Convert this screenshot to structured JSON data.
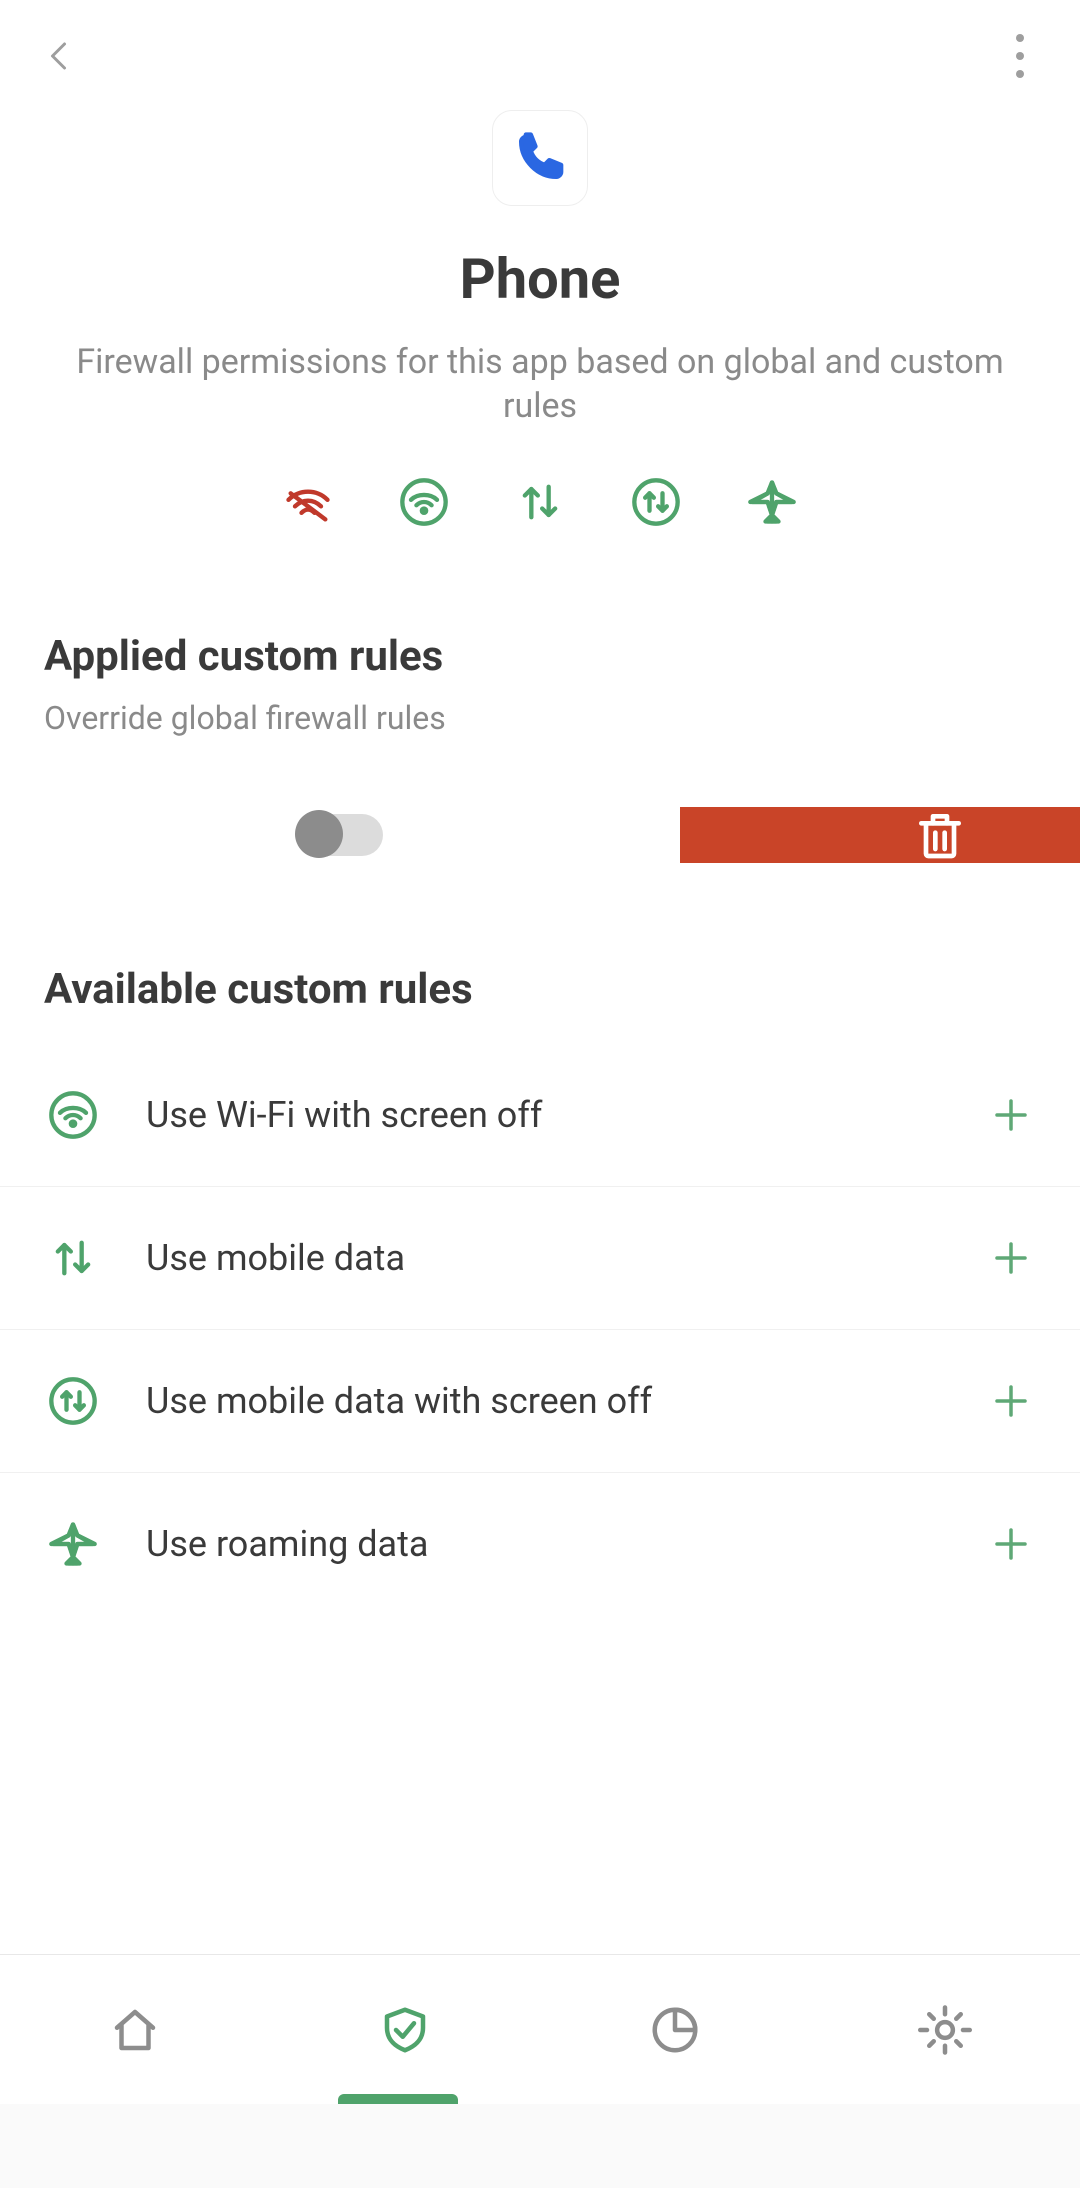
{
  "app": {
    "title": "Phone",
    "subtitle": "Firewall permissions for this app based on global and custom rules"
  },
  "permission_icons": [
    {
      "name": "wifi-blocked",
      "color": "red"
    },
    {
      "name": "wifi-circle",
      "color": "green"
    },
    {
      "name": "mobile-data",
      "color": "green"
    },
    {
      "name": "mobile-data-circle",
      "color": "green"
    },
    {
      "name": "airplane",
      "color": "green"
    }
  ],
  "sections": {
    "applied": {
      "title": "Applied custom rules",
      "subtitle": "Override global firewall rules"
    },
    "available": {
      "title": "Available custom rules"
    }
  },
  "applied_rule": {
    "toggle_on": false
  },
  "available_rules": [
    {
      "icon": "wifi-circle",
      "label": "Use Wi-Fi with screen off"
    },
    {
      "icon": "mobile-data",
      "label": "Use mobile data"
    },
    {
      "icon": "mobile-data-circle",
      "label": "Use mobile data with screen off"
    },
    {
      "icon": "airplane",
      "label": "Use roaming data"
    }
  ],
  "bottom_nav": [
    {
      "name": "home",
      "active": false
    },
    {
      "name": "shield",
      "active": true
    },
    {
      "name": "chart",
      "active": false
    },
    {
      "name": "settings",
      "active": false
    }
  ]
}
